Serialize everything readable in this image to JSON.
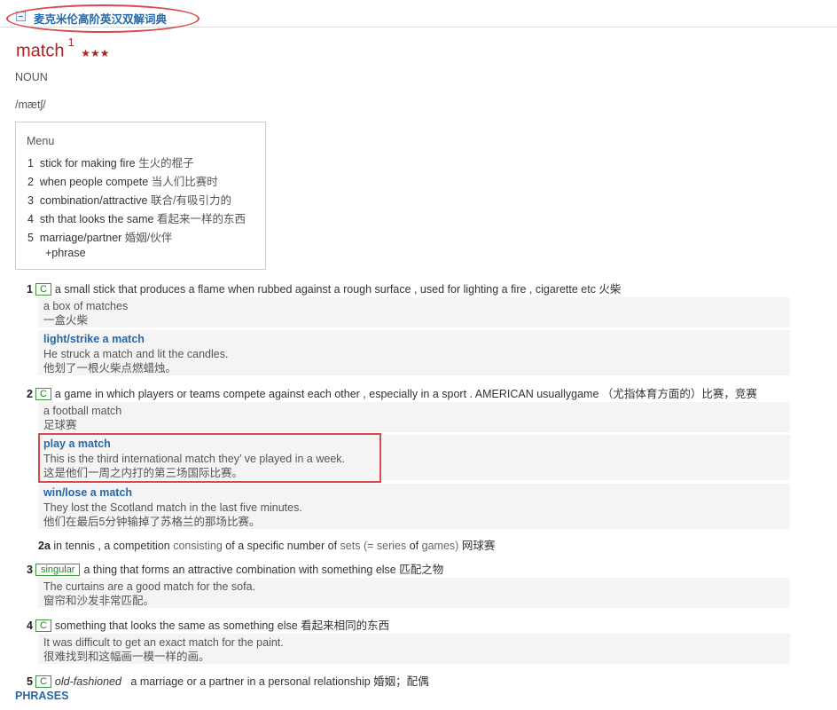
{
  "header": {
    "dictionary_title": "麦克米伦高阶英汉双解词典"
  },
  "entry": {
    "headword": "match",
    "homograph": "1",
    "stars": "★★★",
    "pos": "NOUN",
    "pronunciation": "/mætʃ/"
  },
  "menu": {
    "title": "Menu",
    "items": [
      {
        "n": "1",
        "en": "stick for making fire",
        "zh": "生火的棍子"
      },
      {
        "n": "2",
        "en": "when people compete",
        "zh": "当人们比赛时"
      },
      {
        "n": "3",
        "en": "combination/attractive",
        "zh": "联合/有吸引力的"
      },
      {
        "n": "4",
        "en": "sth that looks the same",
        "zh": "看起来一样的东西"
      },
      {
        "n": "5",
        "en": "marriage/partner",
        "zh": "婚姻/伙伴"
      }
    ],
    "phrase_link": "+phrase"
  },
  "senses": {
    "s1": {
      "num": "1",
      "label": "C",
      "def": "a small stick that produces a flame when rubbed against a rough surface , used for lighting a fire , cigarette etc 火柴",
      "ex1": {
        "en": "a box of matches",
        "zh": "一盒火柴"
      },
      "ex2": {
        "phrase": "light/strike a match",
        "en": "He struck a match and lit the candles.",
        "zh": "他划了一根火柴点燃蜡烛。"
      }
    },
    "s2": {
      "num": "2",
      "label": "C",
      "def": "a game in which players or teams compete against each other , especially in a sport . AMERICAN usuallygame （尤指体育方面的）比赛，竞赛",
      "ex1": {
        "en": "a football match",
        "zh": "足球赛"
      },
      "ex2": {
        "phrase": "play a match",
        "en": "This is the third international match they’ ve played in a week.",
        "zh": "这是他们一周之内打的第三场国际比赛。"
      },
      "ex3": {
        "phrase": "win/lose a match",
        "en": "They lost the Scotland match in the last five minutes.",
        "zh": "他们在最后5分钟输掉了苏格兰的那场比赛。"
      }
    },
    "s2a": {
      "num": "2a",
      "t1": "in tennis",
      "t2": ", a competition",
      "t3": "consisting",
      "t4": "of a specific number of",
      "t5": "sets",
      "t6": "(= series",
      "t7": "of",
      "t8": "games)",
      "t9": "网球赛"
    },
    "s3": {
      "num": "3",
      "label": "singular",
      "def": "a thing that forms an attractive combination with something else 匹配之物",
      "ex1": {
        "en": "The curtains are a good match for the sofa.",
        "zh": "窗帘和沙发非常匹配。"
      }
    },
    "s4": {
      "num": "4",
      "label": "C",
      "def": "something that looks the same as something else 看起来相同的东西",
      "ex1": {
        "en": "It was difficult to get an exact match for the paint.",
        "zh": "很难找到和这幅画一模一样的画。"
      }
    },
    "s5": {
      "num": "5",
      "label": "C",
      "register": "old-fashioned",
      "def": "a marriage or a partner in a personal relationship 婚姻；配偶"
    }
  },
  "phrases_heading": "PHRASES",
  "colors": {
    "accent_blue": "#2668a8",
    "headword_red": "#b22222",
    "annotation_red": "#d84a4a",
    "label_green": "#2b7d2b"
  }
}
